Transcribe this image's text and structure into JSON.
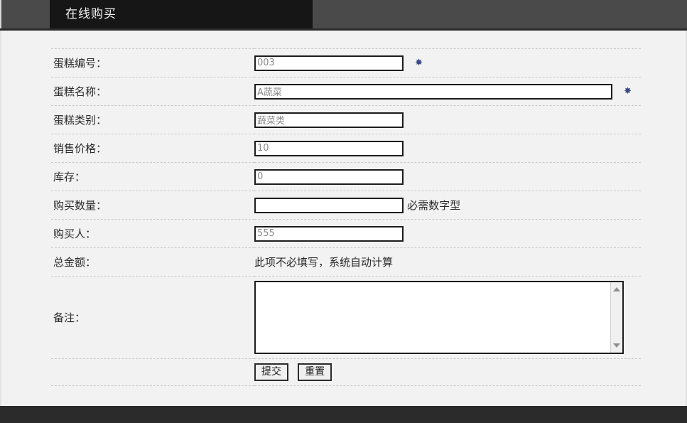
{
  "header": {
    "active_tab": "在线购买"
  },
  "form": {
    "rows": [
      {
        "label": "蛋糕编号：",
        "kind": "input",
        "value": "003",
        "placeholder": "",
        "width": "std",
        "required_mark": "✸",
        "readonly": true
      },
      {
        "label": "蛋糕名称：",
        "kind": "input",
        "value": "A蔬菜",
        "placeholder": "",
        "width": "wide",
        "required_mark": "✸",
        "readonly": true
      },
      {
        "label": "蛋糕类别：",
        "kind": "input",
        "value": "蔬菜类",
        "placeholder": "",
        "width": "std",
        "required_mark": "",
        "readonly": true
      },
      {
        "label": "销售价格：",
        "kind": "input",
        "value": "10",
        "placeholder": "",
        "width": "std",
        "required_mark": "",
        "readonly": true
      },
      {
        "label": "库存：",
        "kind": "input",
        "value": "0",
        "placeholder": "",
        "width": "std",
        "required_mark": "",
        "readonly": true
      },
      {
        "label": "购买数量：",
        "kind": "input",
        "value": "",
        "placeholder": "",
        "width": "std",
        "hint": "必需数字型",
        "required_mark": "",
        "readonly": false
      },
      {
        "label": "购买人：",
        "kind": "input",
        "value": "555",
        "placeholder": "",
        "width": "std",
        "required_mark": "",
        "readonly": true
      },
      {
        "label": "总金额：",
        "kind": "static",
        "text": "此项不必填写，系统自动计算"
      },
      {
        "label": "备注：",
        "kind": "textarea",
        "value": "",
        "placeholder": ""
      }
    ],
    "actions": {
      "submit_label": "提交",
      "reset_label": "重置"
    }
  },
  "icons": {
    "scroll_up": "scroll-up-arrow-icon",
    "scroll_down": "scroll-down-arrow-icon"
  },
  "colors": {
    "page_bg": "#f2f2f2",
    "header_bg": "#4a4a4a",
    "tab_active_bg": "#161616",
    "footer_bg": "#2b2b2b",
    "field_border": "#1c1c1c",
    "divider": "#c9c9c9",
    "readonly_text": "#8a8a8a",
    "required_star": "#3a4a8a"
  }
}
